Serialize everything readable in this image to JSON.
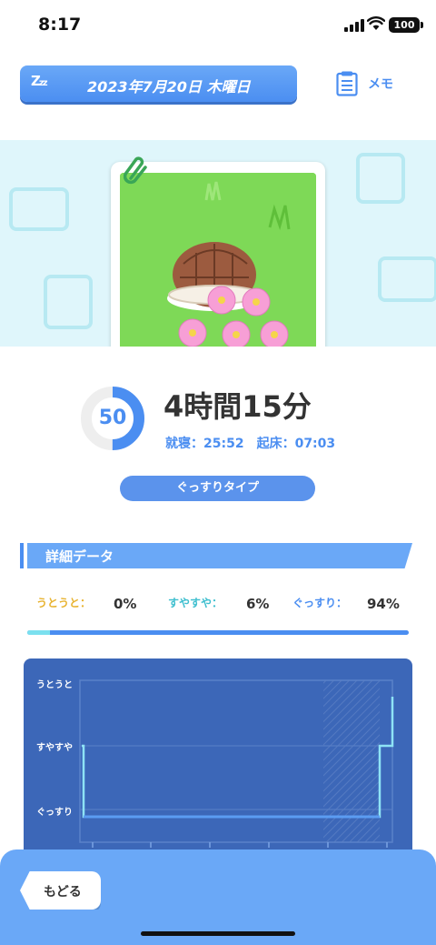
{
  "status_bar": {
    "time": "8:17",
    "battery": "100"
  },
  "header": {
    "date": "2023年7月20日 木曜日",
    "memo_label": "メモ"
  },
  "sleep": {
    "score": "50",
    "score_fraction": 0.5,
    "duration": "4時間15分",
    "bedtime": "就寝：25:52",
    "wakeup": "起床：07:03",
    "type": "ぐっすりタイプ"
  },
  "details": {
    "title": "詳細データ",
    "ratios": [
      {
        "label": "うとうと：",
        "value": "0%",
        "color": "#e8b330"
      },
      {
        "label": "すやすや：",
        "value": "6%",
        "color": "#3fbfcf"
      },
      {
        "label": "ぐっすり：",
        "value": "94%",
        "color": "#4b8ef1"
      }
    ]
  },
  "graph": {
    "levels": [
      "うとうと",
      "すやすや",
      "ぐっすり"
    ]
  },
  "footer": {
    "back_label": "もどる"
  }
}
